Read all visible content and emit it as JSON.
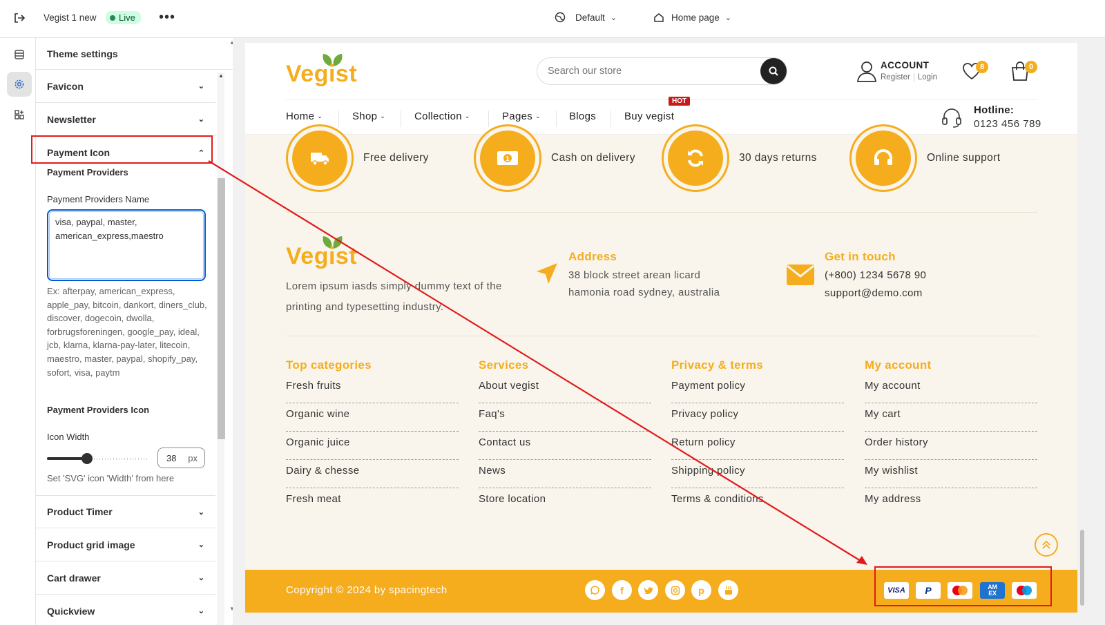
{
  "topbar": {
    "store_name": "Vegist 1 new",
    "live_badge": "Live",
    "theme_select": "Default",
    "page_select": "Home page"
  },
  "panel": {
    "title": "Theme settings",
    "sections": {
      "favicon": "Favicon",
      "newsletter": "Newsletter",
      "payment_icon": "Payment Icon",
      "product_timer": "Product Timer",
      "product_grid_image": "Product grid image",
      "cart_drawer": "Cart drawer",
      "quickview": "Quickview"
    },
    "payment": {
      "providers_heading": "Payment Providers",
      "name_label": "Payment Providers Name",
      "name_value": "visa, paypal, master,\namerican_express,maestro",
      "help_text": "Ex: afterpay, american_express, apple_pay, bitcoin, dankort, diners_club, discover, dogecoin, dwolla, forbrugsforeningen, google_pay, ideal, jcb, klarna, klarna-pay-later, litecoin, maestro, master, paypal, shopify_pay, sofort, visa, paytm",
      "icon_heading": "Payment Providers Icon",
      "width_label": "Icon Width",
      "width_value": "38",
      "width_unit": "px",
      "width_fraction": 0.39,
      "width_help": "Set 'SVG' icon 'Width' from here"
    }
  },
  "store": {
    "logo": "Vegist",
    "search_placeholder": "Search our store",
    "account": {
      "title": "ACCOUNT",
      "register": "Register",
      "login": "Login"
    },
    "wishlist_count": "8",
    "cart_count": "0",
    "nav": {
      "home": "Home",
      "shop": "Shop",
      "collection": "Collection",
      "pages": "Pages",
      "blogs": "Blogs",
      "buy": "Buy vegist",
      "hot": "HOT"
    },
    "hotline": {
      "label": "Hotline:",
      "number": "0123 456 789"
    },
    "features": {
      "delivery": "Free delivery",
      "cash": "Cash on delivery",
      "returns": "30 days returns",
      "support": "Online support"
    },
    "about_text": "Lorem ipsum iasds simply dummy text of the printing and typesetting industry.",
    "address": {
      "title": "Address",
      "line1": "38 block street arean licard",
      "line2": "hamonia road sydney, australia"
    },
    "contact": {
      "title": "Get in touch",
      "phone": "(+800) 1234 5678 90",
      "email": "support@demo.com"
    },
    "columns": [
      {
        "title": "Top categories",
        "items": [
          "Fresh fruits",
          "Organic wine",
          "Organic juice",
          "Dairy & chesse",
          "Fresh meat"
        ]
      },
      {
        "title": "Services",
        "items": [
          "About vegist",
          "Faq's",
          "Contact us",
          "News",
          "Store location"
        ]
      },
      {
        "title": "Privacy & terms",
        "items": [
          "Payment policy",
          "Privacy policy",
          "Return policy",
          "Shipping policy",
          "Terms & conditions"
        ]
      },
      {
        "title": "My account",
        "items": [
          "My account",
          "My cart",
          "Order history",
          "My wishlist",
          "My address"
        ]
      }
    ],
    "copyright": "Copyright © 2024 by spacingtech",
    "payment_icons": {
      "visa": "VISA",
      "paypal": "P",
      "amex": "AM EX"
    }
  },
  "colors": {
    "accent": "#f5ad1d",
    "annotation": "#e01b1b",
    "live": "#29845a"
  }
}
